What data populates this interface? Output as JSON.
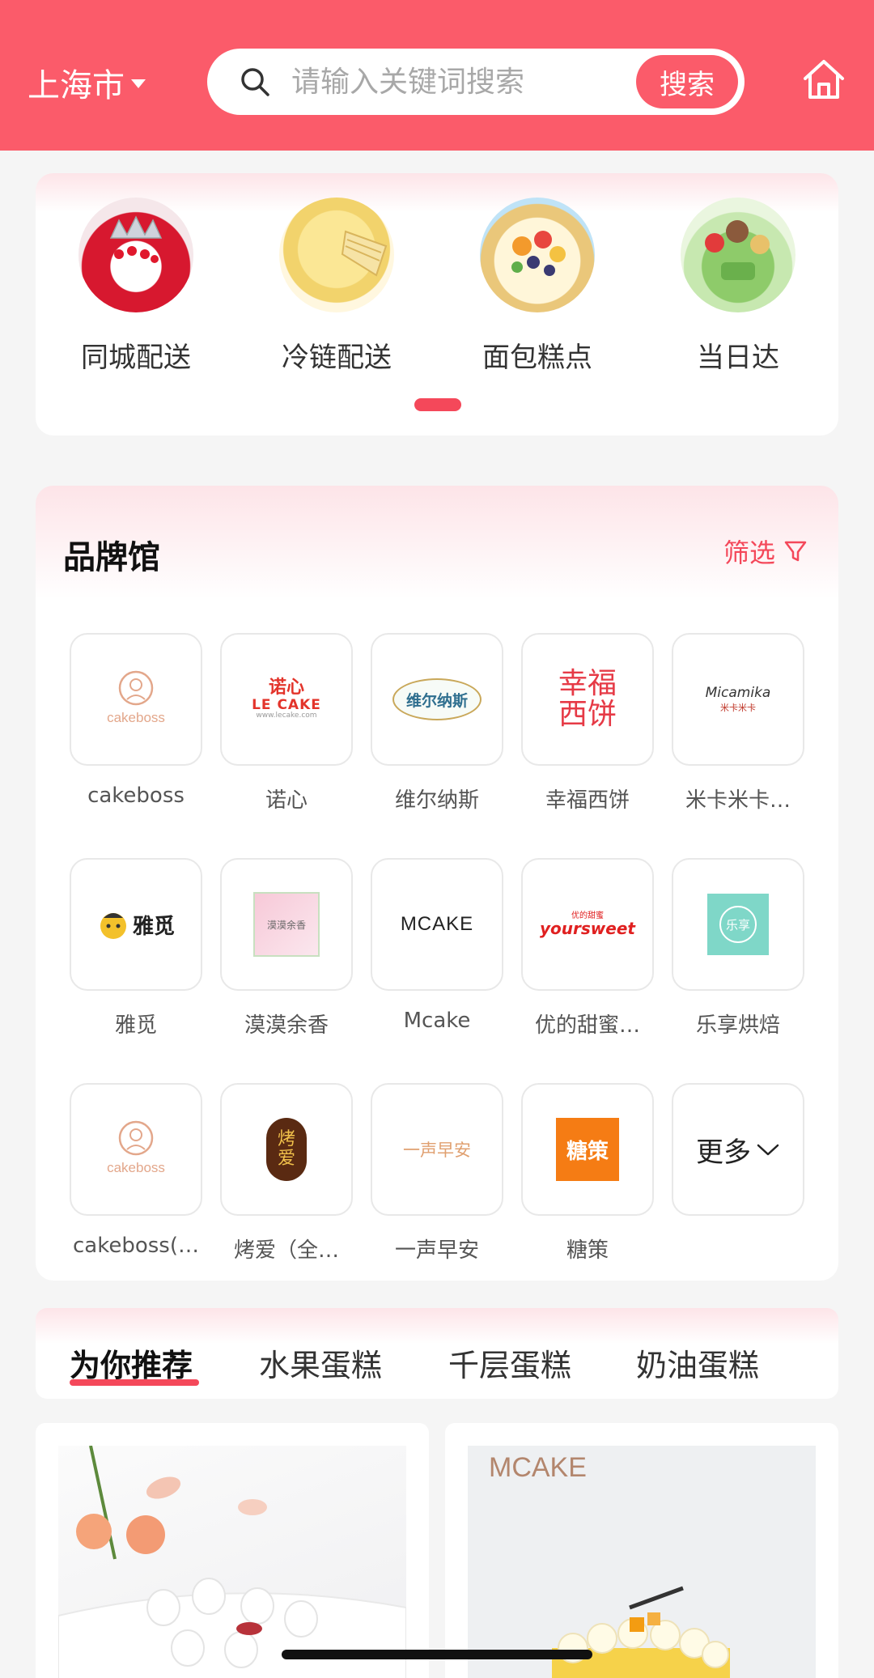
{
  "header": {
    "city": "上海市",
    "search_placeholder": "请输入关键词搜索",
    "search_button": "搜索"
  },
  "categories": [
    {
      "label": "同城配送",
      "icon": "strawberry-cake"
    },
    {
      "label": "冷链配送",
      "icon": "mille-crepe-cake"
    },
    {
      "label": "面包糕点",
      "icon": "fruit-tart"
    },
    {
      "label": "当日达",
      "icon": "matcha-cake"
    }
  ],
  "brands": {
    "title": "品牌馆",
    "filter_label": "筛选",
    "items": [
      {
        "name": "cakeboss",
        "logo_text": "cakeboss"
      },
      {
        "name": "诺心",
        "logo_text": "诺心"
      },
      {
        "name": "维尔纳斯",
        "logo_text": "维尔纳斯"
      },
      {
        "name": "幸福西饼",
        "logo_text": "幸福西饼"
      },
      {
        "name": "米卡米卡…",
        "logo_text": "Micamika"
      },
      {
        "name": "雅觅",
        "logo_text": "雅觅"
      },
      {
        "name": "漠漠余香",
        "logo_text": "漠漠余香"
      },
      {
        "name": "Mcake",
        "logo_text": "MCAKE"
      },
      {
        "name": "优的甜蜜…",
        "logo_text": "yoursweet"
      },
      {
        "name": "乐享烘焙",
        "logo_text": "乐享"
      },
      {
        "name": "cakeboss(…",
        "logo_text": "cakeboss"
      },
      {
        "name": "烤爱（全…",
        "logo_text": "烤爱"
      },
      {
        "name": "一声早安",
        "logo_text": "一声早安"
      },
      {
        "name": "糖策",
        "logo_text": "糖策"
      }
    ],
    "more_label": "更多"
  },
  "tabs": [
    {
      "label": "为你推荐",
      "active": true
    },
    {
      "label": "水果蛋糕",
      "active": false
    },
    {
      "label": "千层蛋糕",
      "active": false
    },
    {
      "label": "奶油蛋糕",
      "active": false
    }
  ],
  "products": [
    {
      "brand_logo": ""
    },
    {
      "brand_logo": "MCAKE"
    }
  ],
  "colors": {
    "primary": "#fb5b6a",
    "accent": "#f4485a"
  }
}
